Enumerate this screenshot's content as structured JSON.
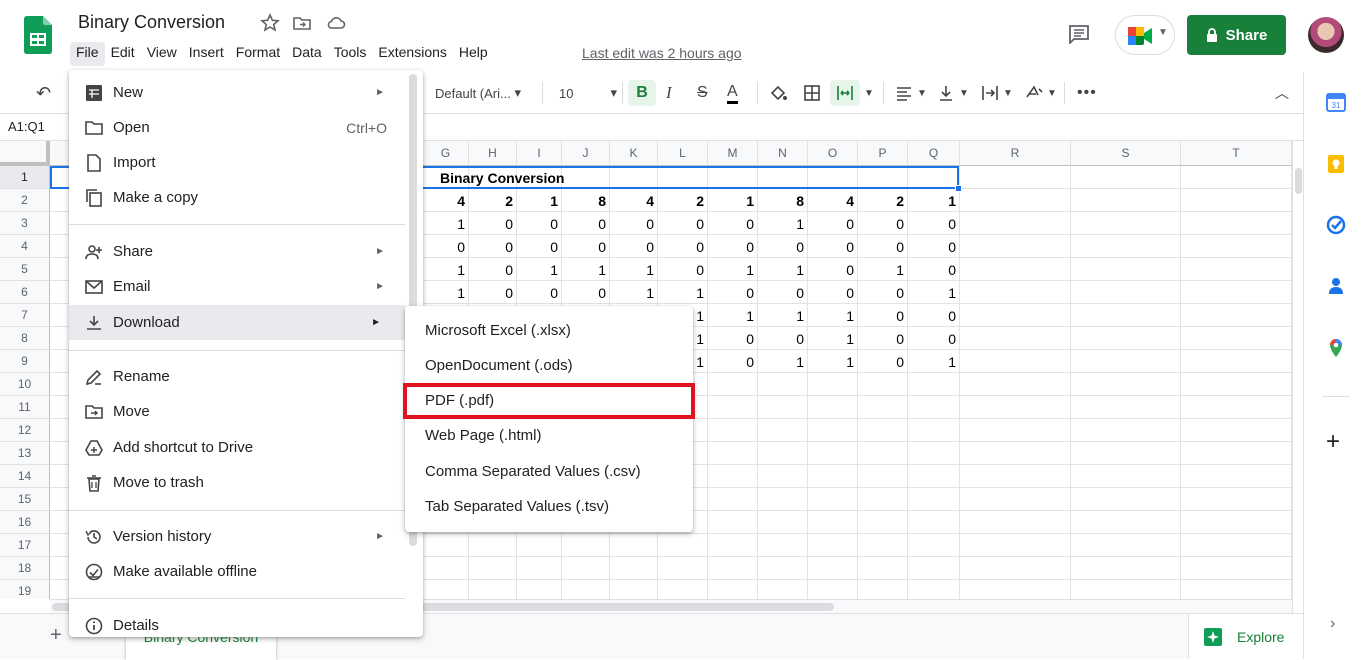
{
  "header": {
    "title": "Binary Conversion",
    "last_edit": "Last edit was 2 hours ago",
    "share_label": "Share"
  },
  "menubar": [
    "File",
    "Edit",
    "View",
    "Insert",
    "Format",
    "Data",
    "Tools",
    "Extensions",
    "Help"
  ],
  "toolbar": {
    "font": "Default (Ari...",
    "font_size": "10",
    "bold": "B",
    "italic": "I",
    "strike": "S",
    "text_color": "A"
  },
  "formula_bar": {
    "name_box": "A1:Q1"
  },
  "grid": {
    "visible_columns": [
      "G",
      "H",
      "I",
      "J",
      "K",
      "L",
      "M",
      "N",
      "O",
      "P",
      "Q",
      "R",
      "S",
      "T"
    ],
    "row_numbers": [
      "1",
      "2",
      "3",
      "4",
      "5",
      "6",
      "7",
      "8",
      "9",
      "10",
      "11",
      "12",
      "13",
      "14",
      "15",
      "16",
      "17",
      "18",
      "19"
    ],
    "title_cell": "Binary Conversion",
    "rows": [
      {
        "row": "2",
        "values": [
          "4",
          "2",
          "1",
          "8",
          "4",
          "2",
          "1",
          "8",
          "4",
          "2",
          "1"
        ],
        "bold": true
      },
      {
        "row": "3",
        "values": [
          "1",
          "0",
          "0",
          "0",
          "0",
          "0",
          "0",
          "1",
          "0",
          "0",
          "0"
        ]
      },
      {
        "row": "4",
        "values": [
          "0",
          "0",
          "0",
          "0",
          "0",
          "0",
          "0",
          "0",
          "0",
          "0",
          "0"
        ]
      },
      {
        "row": "5",
        "values": [
          "1",
          "0",
          "1",
          "1",
          "1",
          "0",
          "1",
          "1",
          "0",
          "1",
          "0"
        ]
      },
      {
        "row": "6",
        "values": [
          "1",
          "0",
          "0",
          "0",
          "1",
          "1",
          "0",
          "0",
          "0",
          "0",
          "1"
        ]
      },
      {
        "row": "7",
        "values": [
          "",
          "",
          "",
          "",
          "",
          "1",
          "1",
          "1",
          "1",
          "0",
          "0"
        ]
      },
      {
        "row": "8",
        "values": [
          "",
          "",
          "",
          "",
          "",
          "1",
          "0",
          "0",
          "1",
          "0",
          "0"
        ]
      },
      {
        "row": "9",
        "values": [
          "",
          "",
          "",
          "",
          "",
          "1",
          "0",
          "1",
          "1",
          "0",
          "1"
        ]
      }
    ]
  },
  "file_menu": {
    "items": [
      {
        "label": "New",
        "icon": "new-sheet-icon",
        "submenu": true
      },
      {
        "label": "Open",
        "icon": "folder-icon",
        "shortcut": "Ctrl+O"
      },
      {
        "label": "Import",
        "icon": "file-import-icon"
      },
      {
        "label": "Make a copy",
        "icon": "copy-icon"
      },
      {
        "label": "Share",
        "icon": "person-add-icon",
        "submenu": true
      },
      {
        "label": "Email",
        "icon": "email-icon",
        "submenu": true
      },
      {
        "label": "Download",
        "icon": "download-icon",
        "submenu": true
      },
      {
        "label": "Rename",
        "icon": "rename-icon"
      },
      {
        "label": "Move",
        "icon": "move-folder-icon"
      },
      {
        "label": "Add shortcut to Drive",
        "icon": "drive-shortcut-icon"
      },
      {
        "label": "Move to trash",
        "icon": "trash-icon"
      },
      {
        "label": "Version history",
        "icon": "history-icon",
        "submenu": true
      },
      {
        "label": "Make available offline",
        "icon": "offline-icon"
      },
      {
        "label": "Details",
        "icon": "info-icon"
      }
    ]
  },
  "download_submenu": {
    "items": [
      "Microsoft Excel (.xlsx)",
      "OpenDocument (.ods)",
      "PDF (.pdf)",
      "Web Page (.html)",
      "Comma Separated Values (.csv)",
      "Tab Separated Values (.tsv)"
    ],
    "highlighted": "PDF (.pdf)",
    "highlight_color": "#e0141e"
  },
  "sheet_tabs": {
    "active": "Binary Conversion",
    "explore_label": "Explore"
  },
  "colors": {
    "brand_green": "#188038",
    "selection_blue": "#1a73e8"
  }
}
